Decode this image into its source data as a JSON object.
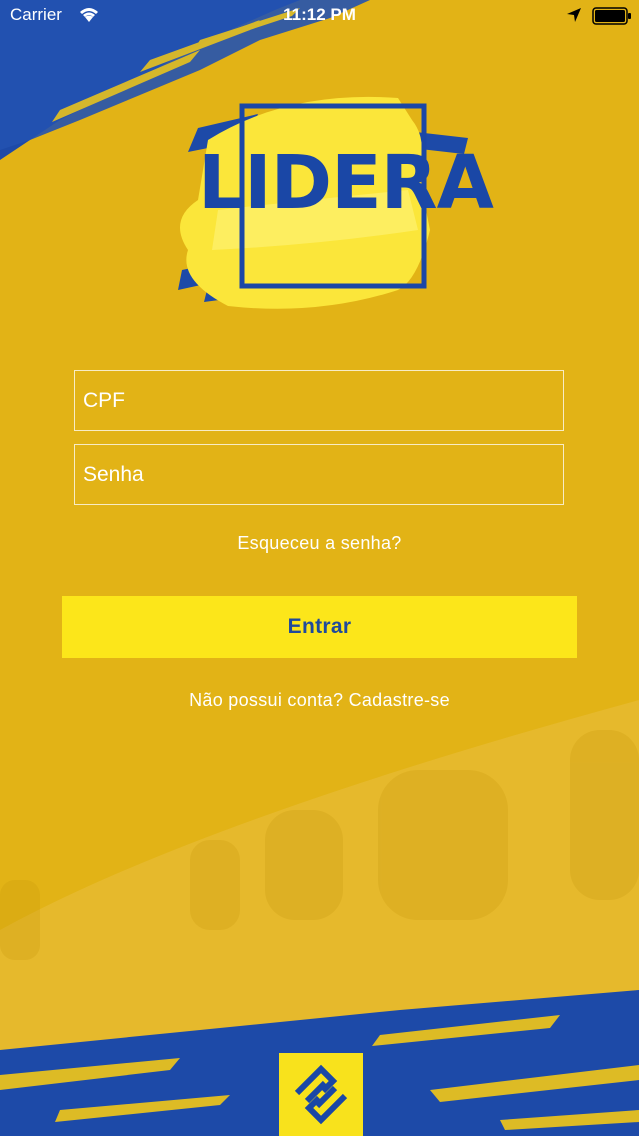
{
  "status_bar": {
    "carrier": "Carrier",
    "time": "11:12 PM",
    "icons": [
      "wifi-icon",
      "location-arrow-icon",
      "battery-icon"
    ]
  },
  "logo": {
    "text": "LIDERA"
  },
  "form": {
    "cpf_placeholder": "CPF",
    "password_placeholder": "Senha",
    "forgot_password": "Esqueceu a senha?",
    "submit_label": "Entrar",
    "signup_link": "Não possui conta? Cadastre-se"
  },
  "footer": {
    "brand_icon": "banco-do-brasil-logo-icon"
  },
  "colors": {
    "background": "#e2b316",
    "brand_blue": "#1a47a6",
    "button_yellow": "#fce61a",
    "button_text": "#1f4a9c"
  }
}
